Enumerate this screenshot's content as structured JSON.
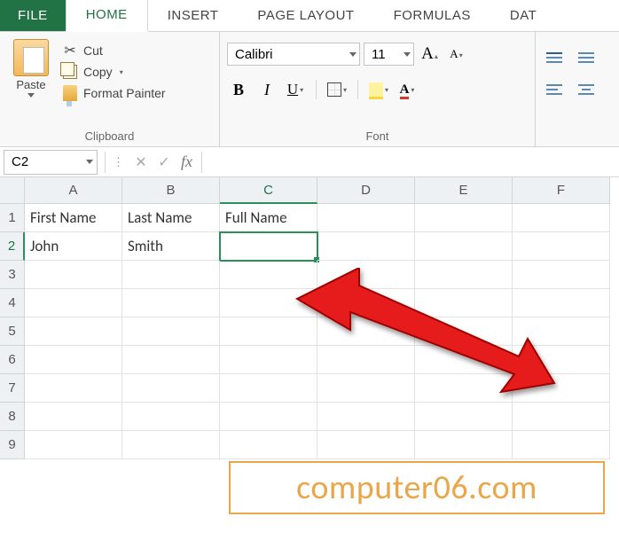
{
  "tabs": {
    "file": "FILE",
    "home": "HOME",
    "insert": "INSERT",
    "page_layout": "PAGE LAYOUT",
    "formulas": "FORMULAS",
    "data": "DAT"
  },
  "clipboard": {
    "paste": "Paste",
    "cut": "Cut",
    "copy": "Copy",
    "format_painter": "Format Painter",
    "group_label": "Clipboard"
  },
  "font_group": {
    "font_name": "Calibri",
    "font_size": "11",
    "bold": "B",
    "italic": "I",
    "underline": "U",
    "font_color_letter": "A",
    "increase_a": "A",
    "decrease_a": "A",
    "group_label": "Font"
  },
  "formula_bar": {
    "cell_ref": "C2",
    "fx": "fx"
  },
  "columns": [
    "A",
    "B",
    "C",
    "D",
    "E",
    "F"
  ],
  "rows": [
    "1",
    "2",
    "3",
    "4",
    "5",
    "6",
    "7",
    "8",
    "9"
  ],
  "cells": {
    "A1": "First Name",
    "B1": "Last Name",
    "C1": "Full Name",
    "A2": "John",
    "B2": "Smith"
  },
  "selected_cell": "C2",
  "watermark": "computer06.com"
}
